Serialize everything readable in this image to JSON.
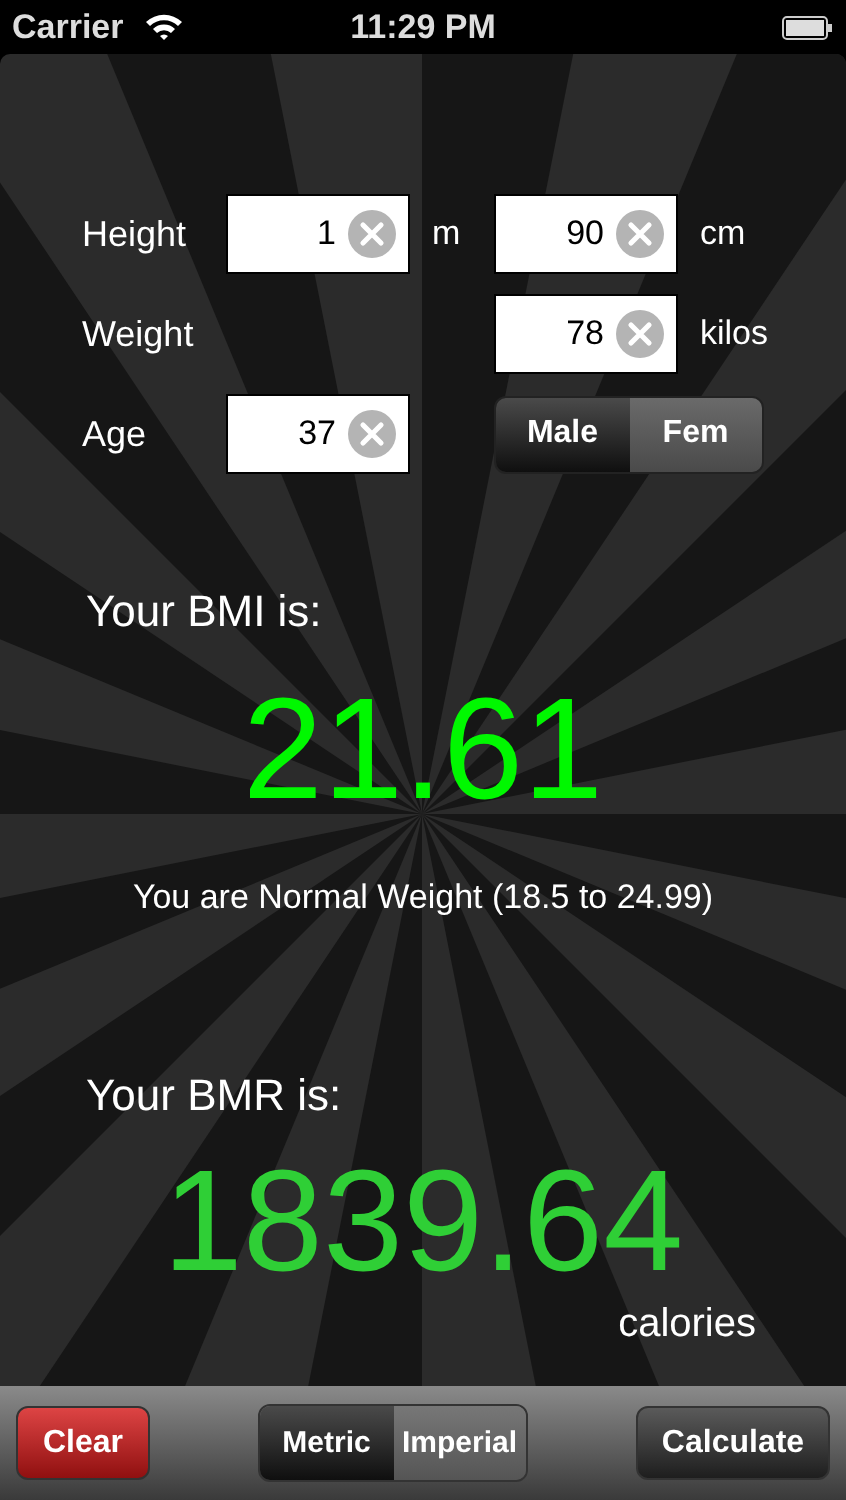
{
  "status_bar": {
    "carrier": "Carrier",
    "time": "11:29 PM"
  },
  "form": {
    "rows": [
      {
        "label": "Height",
        "left_input": {
          "value": "1",
          "unit": "m"
        },
        "right_input": {
          "value": "90",
          "unit": "cm"
        }
      },
      {
        "label": "Weight",
        "right_input": {
          "value": "78",
          "unit": "kilos"
        }
      },
      {
        "label": "Age",
        "left_input": {
          "value": "37"
        },
        "segment": [
          {
            "label": "Male",
            "selected": true
          },
          {
            "label": "Fem",
            "selected": false
          }
        ]
      }
    ]
  },
  "bmi": {
    "heading": "Your BMI is:",
    "value": "21.61",
    "verdict": "You are Normal Weight (18.5 to 24.99)"
  },
  "bmr": {
    "heading": "Your BMR is:",
    "value": "1839.64",
    "unit": "calories"
  },
  "toolbar": {
    "clear": "Clear",
    "units": [
      {
        "label": "Metric",
        "selected": true
      },
      {
        "label": "Imperial",
        "selected": false
      }
    ],
    "calculate": "Calculate"
  }
}
